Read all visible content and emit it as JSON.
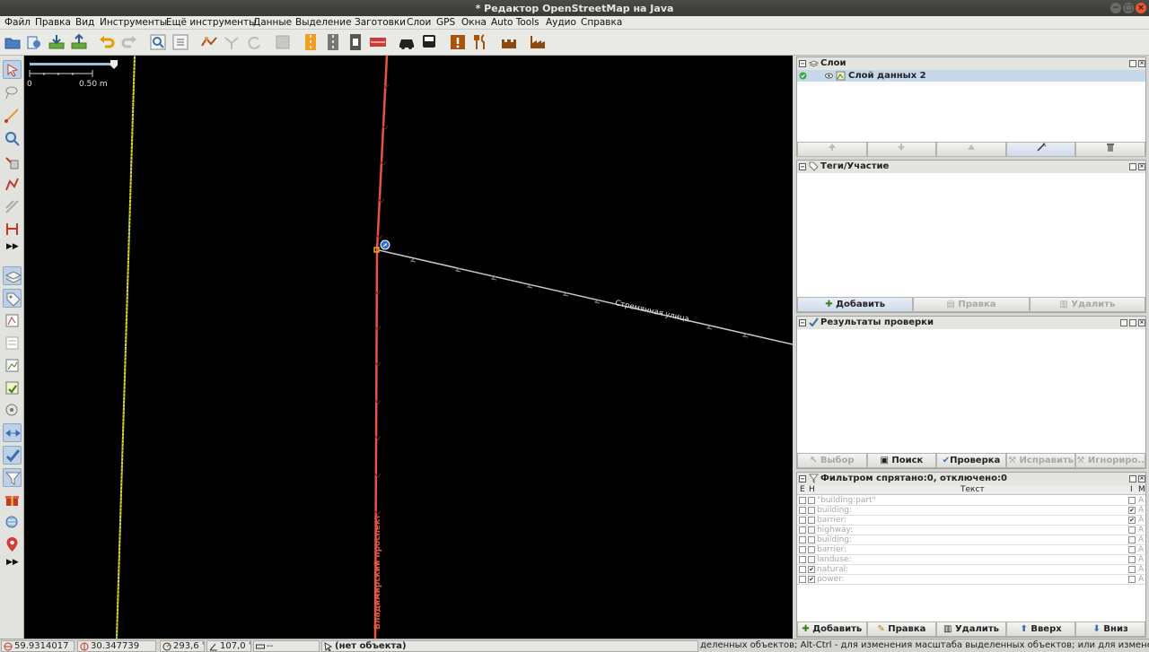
{
  "window": {
    "title": "* Редактор OpenStreetMap на Java",
    "minimize_glyph": "−",
    "maximize_glyph": "□",
    "close_glyph": "×"
  },
  "menu": [
    "Файл",
    "Правка",
    "Вид",
    "Инструменты",
    "Ещё инструменты",
    "Данные",
    "Выделение",
    "Заготовки",
    "Слои",
    "GPS",
    "Окна",
    "Auto Tools",
    "Аудио",
    "Справка"
  ],
  "toolbar_icons": [
    "open-file-icon",
    "open-location-icon",
    "download-icon",
    "upload-icon",
    "undo-icon",
    "redo-icon",
    "zoom-search-icon",
    "preferences-icon",
    "wireframe-icon",
    "split-way-icon",
    "refresh-icon",
    "blank-icon",
    "road-yellow-icon",
    "road-gray-icon",
    "traffic-signals-icon",
    "barrier-red-icon",
    "car-icon",
    "bus-icon",
    "warning-sign-icon",
    "restaurant-icon",
    "castle-icon",
    "factory-icon"
  ],
  "left_tools": {
    "more_glyph": "▶▶"
  },
  "map": {
    "scale_zero": "0",
    "scale_label": "0.50 m",
    "street_label": "Стремянная улица",
    "vertical_label": "Владимирский проспект"
  },
  "layers_panel": {
    "title": "Слои",
    "layer_name": "Слой данных 2"
  },
  "tags_panel": {
    "title": "Теги/Участие",
    "buttons": [
      "Добавить",
      "Правка",
      "Удалить"
    ]
  },
  "validation_panel": {
    "title": "Результаты проверки",
    "buttons": [
      "Выбор",
      "Поиск",
      "Проверка",
      "Исправить",
      "Игнориро..."
    ]
  },
  "filter_panel": {
    "title": "Фильтром спрятано:0, отключено:0",
    "columns": {
      "e": "E",
      "h": "H",
      "text": "Текст",
      "i": "I",
      "m": "M"
    },
    "rows": [
      {
        "text": "\"building:part\"",
        "e": false,
        "h": false,
        "i": false,
        "m": "A",
        "i_checked": false
      },
      {
        "text": "building:",
        "e": false,
        "h": false,
        "m": "A",
        "i_checked": true
      },
      {
        "text": "barrier:",
        "e": false,
        "h": false,
        "m": "A",
        "i_checked": true
      },
      {
        "text": "highway:",
        "e": false,
        "h": false,
        "m": "A",
        "i_checked": false
      },
      {
        "text": "building:",
        "e": false,
        "h": false,
        "m": "A",
        "i_checked": false
      },
      {
        "text": "barrier:",
        "e": false,
        "h": false,
        "m": "A",
        "i_checked": false
      },
      {
        "text": "landuse:",
        "e": false,
        "h": false,
        "m": "A",
        "i_checked": false
      },
      {
        "text": "natural:",
        "e": false,
        "h": true,
        "m": "A",
        "i_checked": false
      },
      {
        "text": "power:",
        "e": false,
        "h": true,
        "m": "A",
        "i_checked": false
      }
    ],
    "buttons": [
      "Добавить",
      "Правка",
      "Удалить",
      "Вверх",
      "Вниз"
    ]
  },
  "status": {
    "lat": "59.9314017",
    "lon": "30.347739",
    "heading": "293,6 °",
    "angle": "107,0 °",
    "length": "--",
    "selection": "(нет объекта)",
    "help": "деленных объектов; Alt-Ctrl - для изменения масштаба выделенных объектов; или для изменения выделения"
  },
  "colors": {
    "road_primary": "#e8553f",
    "road_residential": "#c8c8c8",
    "boundary": "#d9d93a",
    "map_background": "#000000",
    "layer_highlight": "#c7d8ec"
  }
}
